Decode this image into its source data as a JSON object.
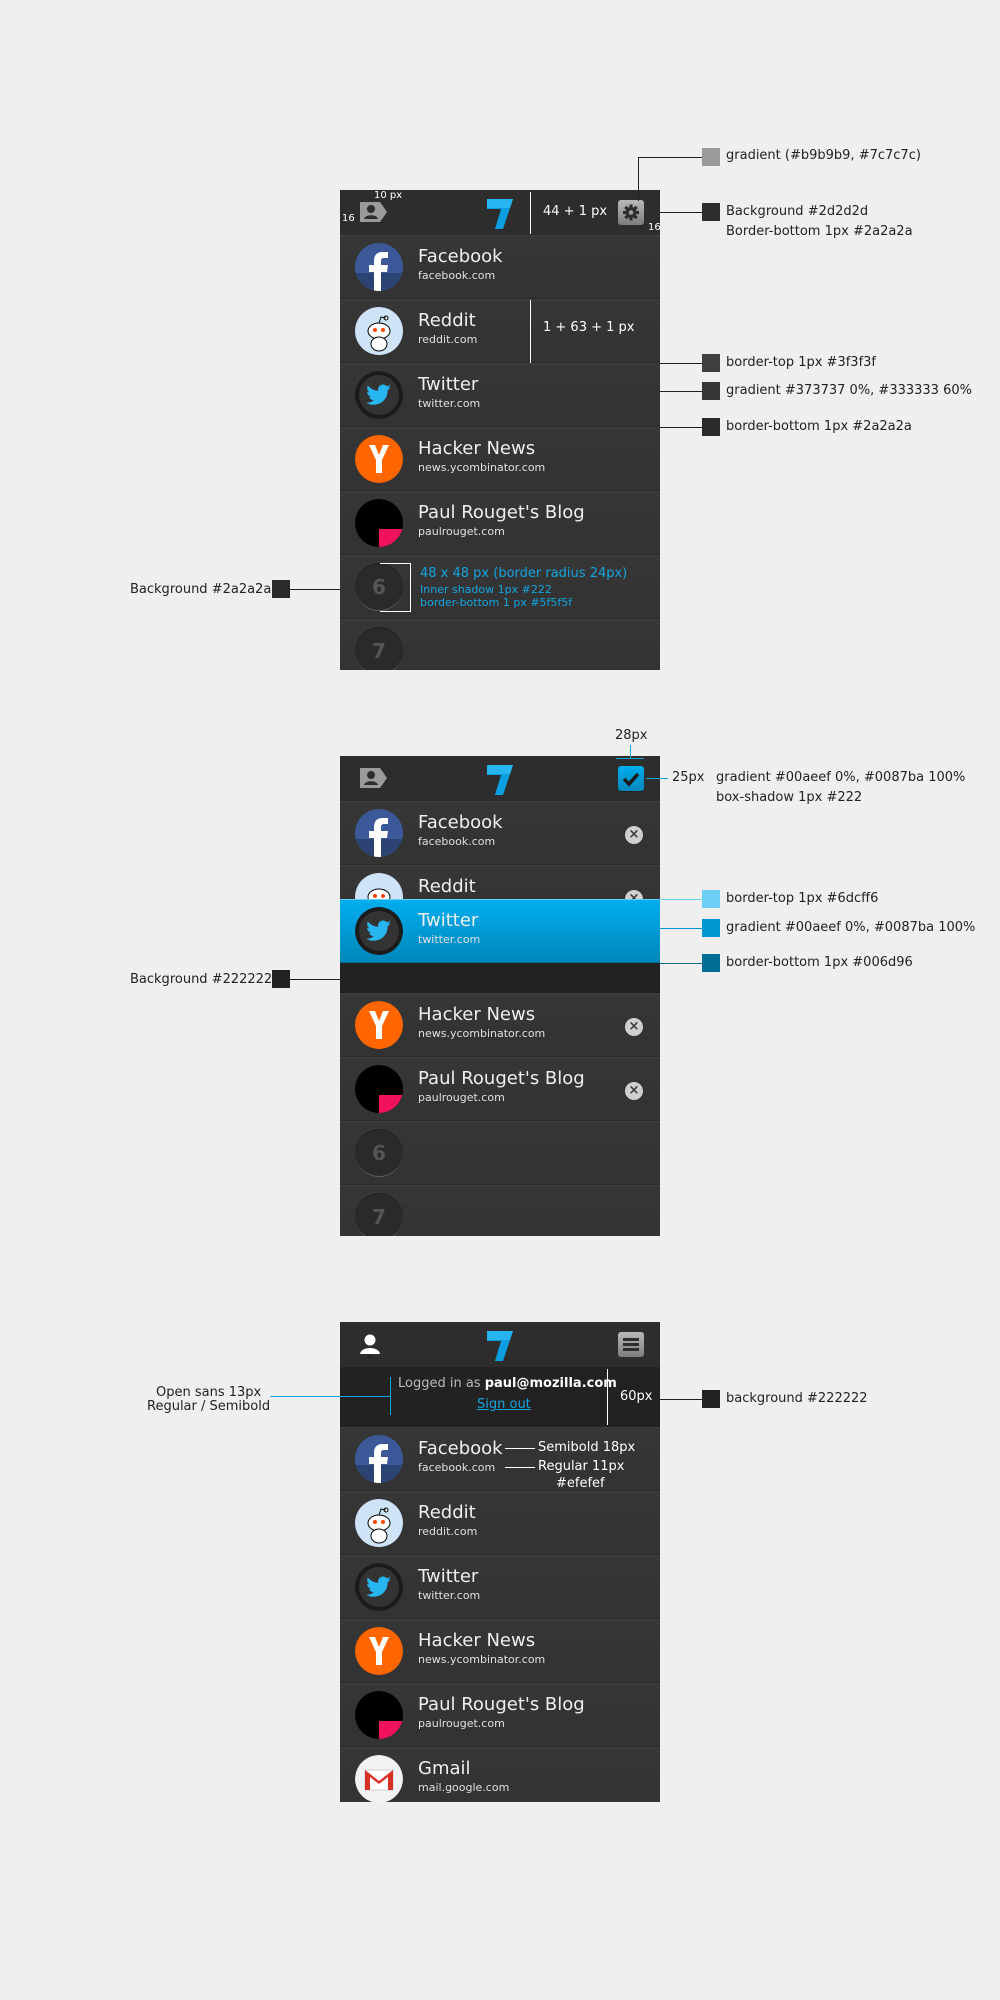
{
  "colors": {
    "accent": "#00aeef",
    "bg": "#2a2a2a",
    "topbar": "#2d2d2d"
  },
  "sites": [
    {
      "title": "Facebook",
      "url": "facebook.com",
      "icon": "facebook-icon"
    },
    {
      "title": "Reddit",
      "url": "reddit.com",
      "icon": "reddit-icon"
    },
    {
      "title": "Twitter",
      "url": "twitter.com",
      "icon": "twitter-icon"
    },
    {
      "title": "Hacker News",
      "url": "news.ycombinator.com",
      "icon": "hacker-news-icon"
    },
    {
      "title": "Paul Rouget's Blog",
      "url": "paulrouget.com",
      "icon": "blog-icon"
    },
    {
      "title": "Gmail",
      "url": "mail.google.com",
      "icon": "gmail-icon"
    }
  ],
  "placeholders": [
    "6",
    "7"
  ],
  "login": {
    "prefix": "Logged in as",
    "email": "paul@mozilla.com",
    "signout": "Sign out"
  },
  "ann1": {
    "gradient": "gradient (#b9b9b9, #7c7c7c)",
    "bg": "Background #2d2d2d",
    "border": "Border-bottom 1px #2a2a2a",
    "h44": "44 + 1 px",
    "h64": "1 + 63 + 1 px",
    "bt": "border-top 1px #3f3f3f",
    "grad": "gradient #373737 0%, #333333 60%",
    "bb": "border-bottom 1px #2a2a2a",
    "bgleft": "Background #2a2a2a",
    "px10": "10 px",
    "px16a": "16",
    "px16b": "16",
    "ph1": "48 x 48 px (border radius 24px)",
    "ph2": "Inner shadow 1px #222",
    "ph3": "border-bottom 1 px #5f5f5f"
  },
  "ann2": {
    "w28": "28px",
    "h25": "25px",
    "grad1": "gradient #00aeef 0%, #0087ba 100%",
    "shadow": "box-shadow 1px #222",
    "bt": "border-top 1px #6dcff6",
    "grad2": "gradient #00aeef 0%, #0087ba 100%",
    "bb": "border-bottom 1px #006d96",
    "bgleft": "Background #222222"
  },
  "ann3": {
    "font1": "Open sans 13px",
    "font2": "Regular / Semibold",
    "h60": "60px",
    "bg": "background #222222",
    "semi": "Semibold 18px",
    "reg": "Regular 11px",
    "col": "#efefef"
  }
}
